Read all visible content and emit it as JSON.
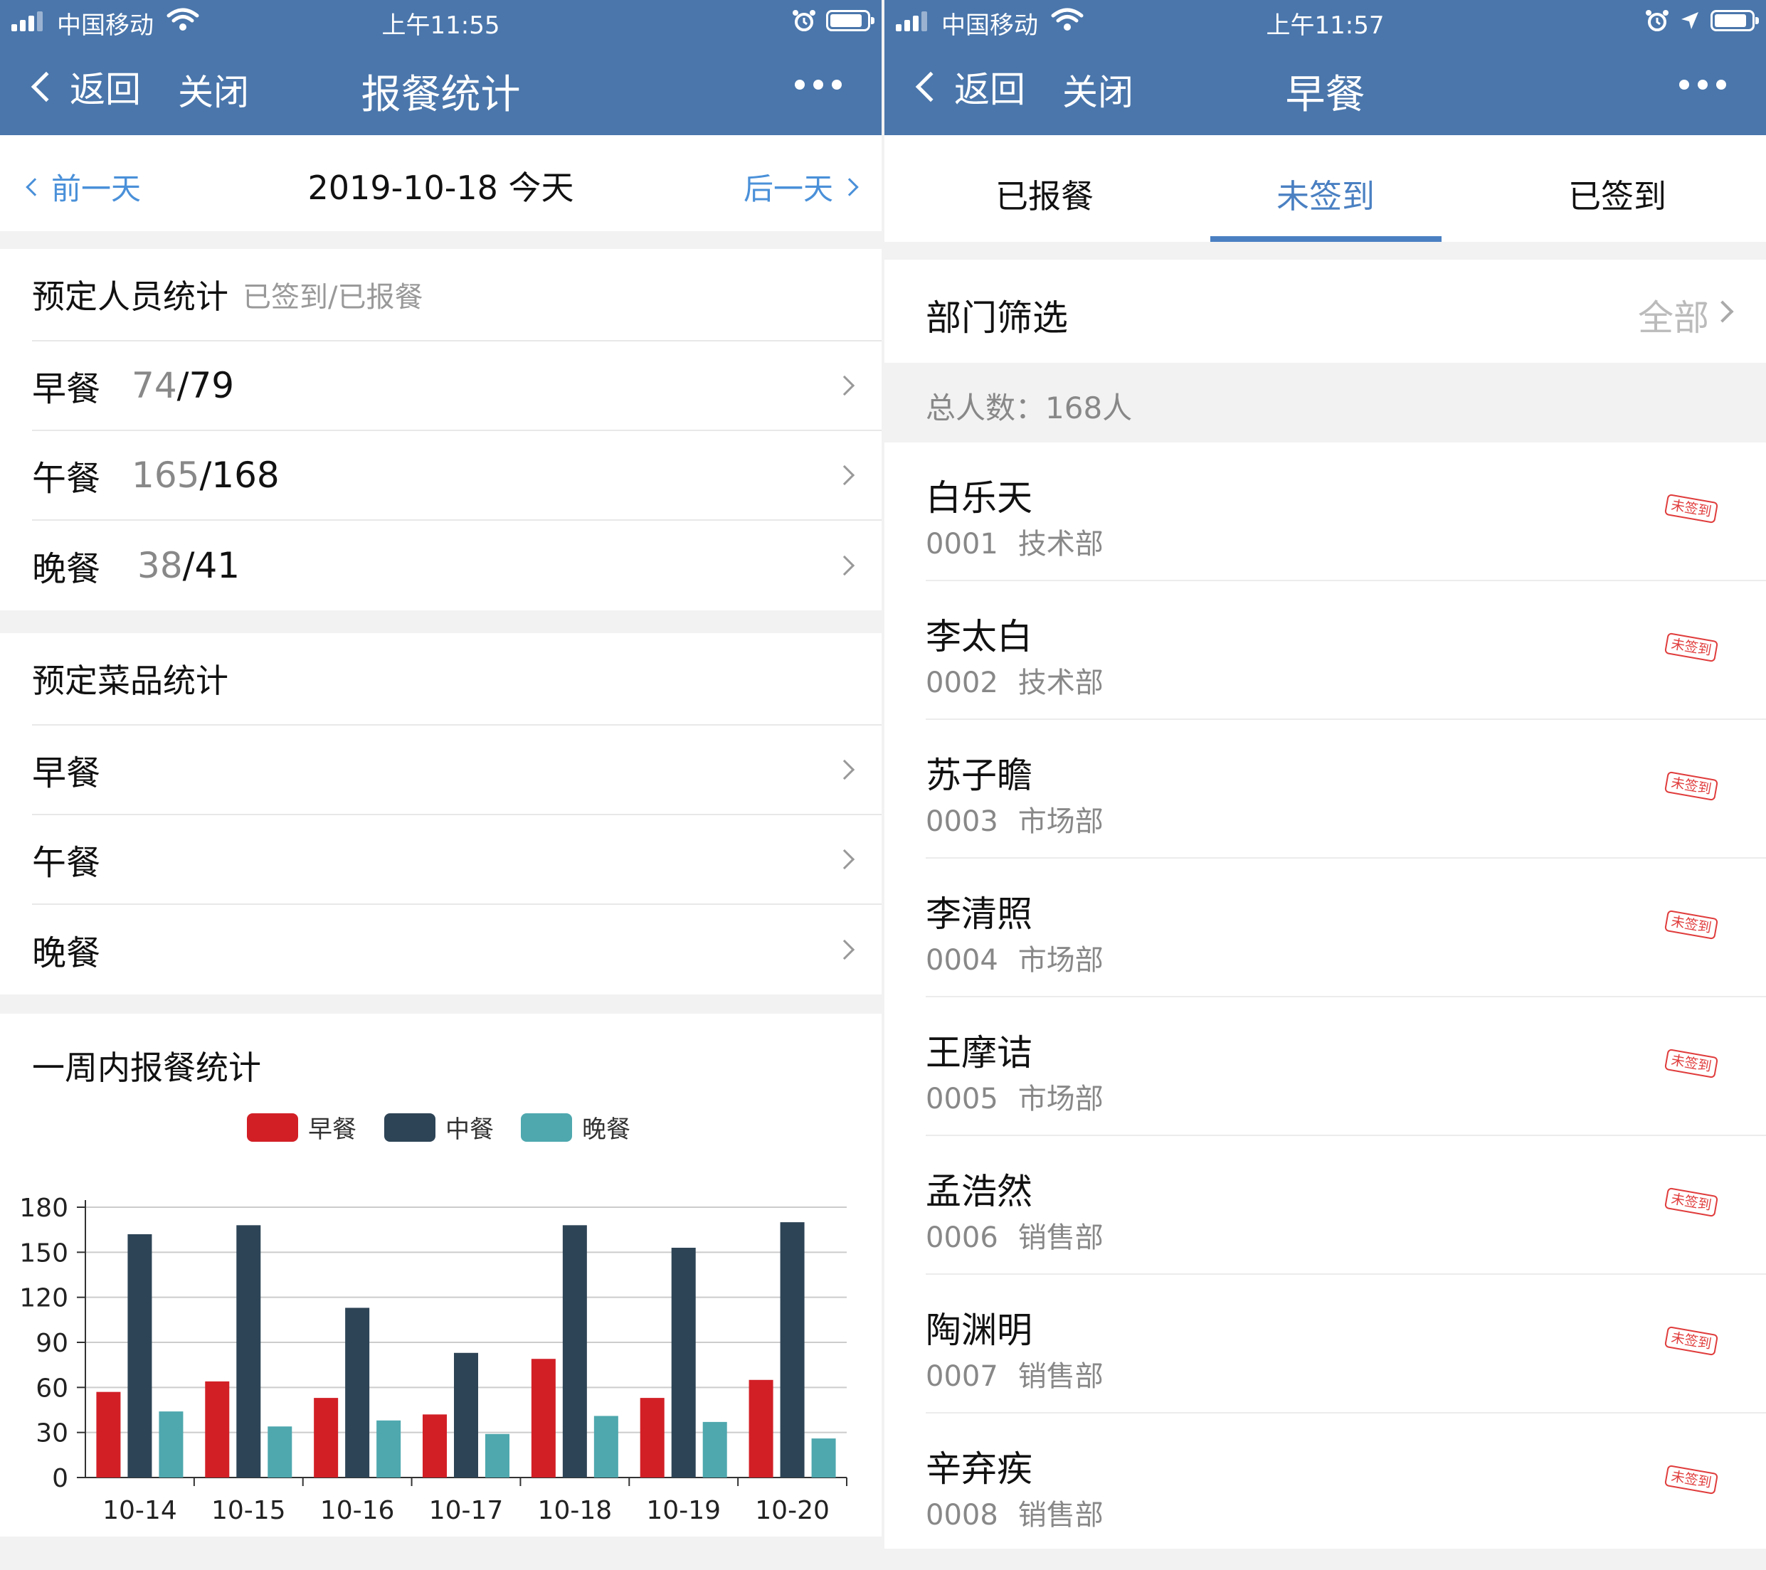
{
  "left": {
    "status": {
      "carrier": "中国移动",
      "time": "上午11:55"
    },
    "nav": {
      "back": "返回",
      "close": "关闭",
      "title": "报餐统计"
    },
    "datebar": {
      "prev": "前一天",
      "current": "2019-10-18 今天",
      "next": "后一天"
    },
    "staff": {
      "title": "预定人员统计",
      "subtitle": "已签到/已报餐",
      "rows": [
        {
          "label": "早餐",
          "signed": "74",
          "ordered": "/79"
        },
        {
          "label": "午餐",
          "signed": "165",
          "ordered": "/168"
        },
        {
          "label": "晚餐",
          "signed": "38",
          "ordered": "/41"
        }
      ]
    },
    "dishes": {
      "title": "预定菜品统计",
      "rows": [
        {
          "label": "早餐"
        },
        {
          "label": "午餐"
        },
        {
          "label": "晚餐"
        }
      ]
    },
    "weekly_title": "一周内报餐统计"
  },
  "chart_data": {
    "type": "bar",
    "categories": [
      "10-14",
      "10-15",
      "10-16",
      "10-17",
      "10-18",
      "10-19",
      "10-20"
    ],
    "series": [
      {
        "name": "早餐",
        "color": "#d21f26",
        "values": [
          57,
          64,
          53,
          42,
          79,
          53,
          65
        ]
      },
      {
        "name": "中餐",
        "color": "#2d4456",
        "values": [
          162,
          168,
          113,
          83,
          168,
          153,
          170
        ]
      },
      {
        "name": "晚餐",
        "color": "#4ea8ae",
        "values": [
          44,
          34,
          38,
          29,
          41,
          37,
          26
        ]
      }
    ],
    "ylim": [
      0,
      180
    ],
    "yticks": [
      0,
      30,
      60,
      90,
      120,
      150,
      180
    ],
    "grid": true,
    "legend": "top-center"
  },
  "right": {
    "status": {
      "carrier": "中国移动",
      "time": "上午11:57"
    },
    "nav": {
      "back": "返回",
      "close": "关闭",
      "title": "早餐"
    },
    "tabs": [
      {
        "label": "已报餐"
      },
      {
        "label": "未签到",
        "active": true
      },
      {
        "label": "已签到"
      }
    ],
    "filter": {
      "label": "部门筛选",
      "value": "全部"
    },
    "total": "总人数：168人",
    "stamp": "未签到",
    "people": [
      {
        "name": "白乐天",
        "id": "0001",
        "dept": "技术部"
      },
      {
        "name": "李太白",
        "id": "0002",
        "dept": "技术部"
      },
      {
        "name": "苏子瞻",
        "id": "0003",
        "dept": "市场部"
      },
      {
        "name": "李清照",
        "id": "0004",
        "dept": "市场部"
      },
      {
        "name": "王摩诘",
        "id": "0005",
        "dept": "市场部"
      },
      {
        "name": "孟浩然",
        "id": "0006",
        "dept": "销售部"
      },
      {
        "name": "陶渊明",
        "id": "0007",
        "dept": "销售部"
      },
      {
        "name": "辛弃疾",
        "id": "0008",
        "dept": "销售部"
      }
    ]
  }
}
